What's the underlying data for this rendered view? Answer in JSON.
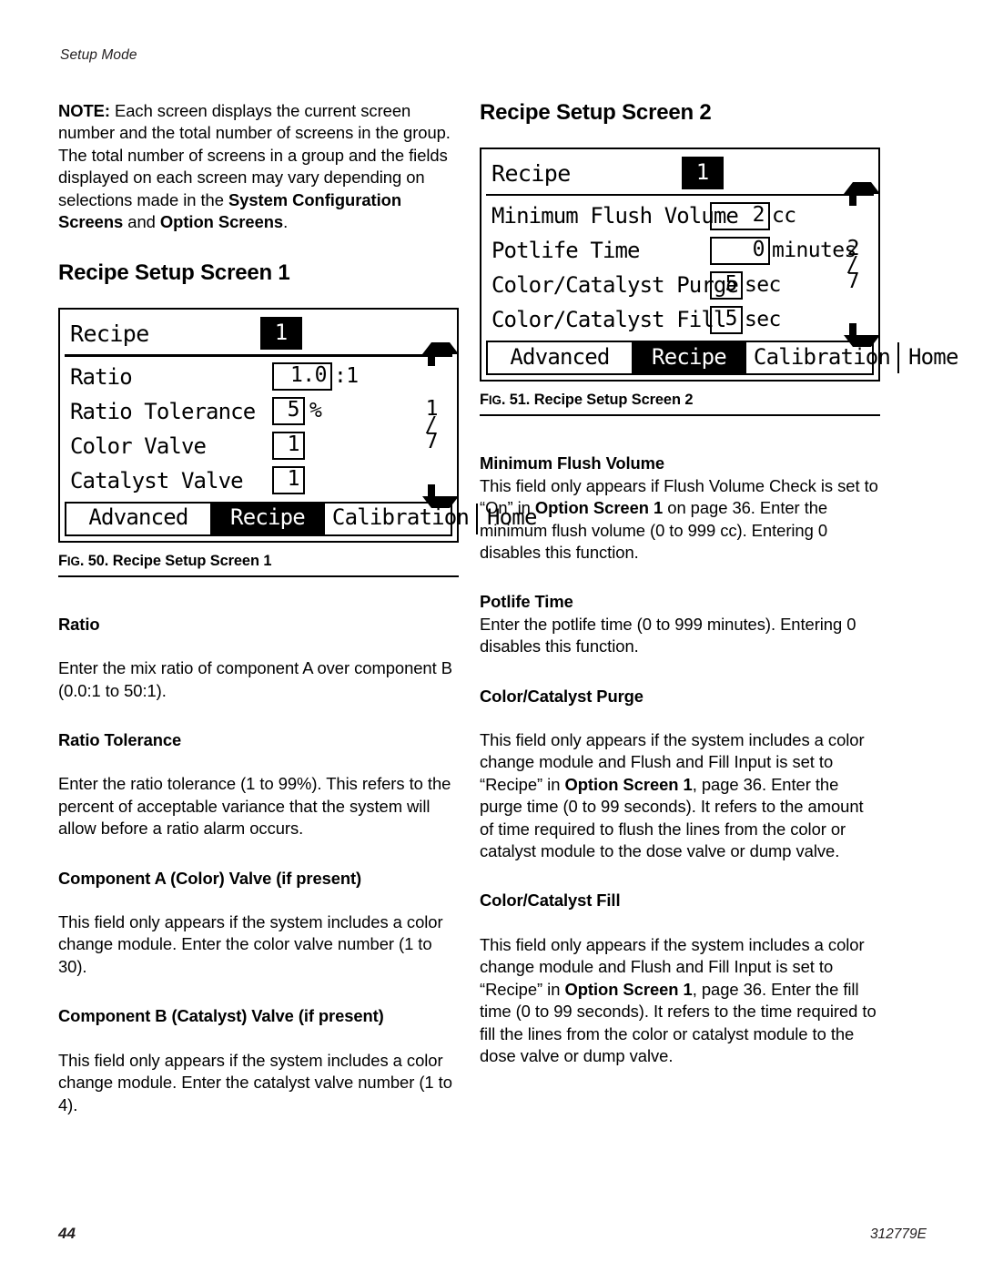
{
  "running_head": "Setup Mode",
  "footer": {
    "page_number": "44",
    "doc_number": "312779E"
  },
  "left_column": {
    "note": {
      "lead": "NOTE:",
      "text_1": " Each screen displays the current screen number and the total number of screens in the group. The total number of screens in a group and the fields displayed on each screen may vary depending on selections made in the ",
      "bold_1": "System Configuration Screens",
      "text_2": " and ",
      "bold_2": "Option Screens",
      "text_3": "."
    },
    "section_title": "Recipe Setup Screen 1",
    "figure_caption": {
      "prefix": "F",
      "small": "IG",
      "rest": ". 50. Recipe Setup Screen 1"
    },
    "sections": [
      {
        "heading": "Ratio",
        "body": "Enter the mix ratio of component A over component B (0.0:1 to 50:1)."
      },
      {
        "heading": "Ratio Tolerance",
        "body": "Enter the ratio tolerance (1 to 99%). This refers to the percent of acceptable variance that the system will allow before a ratio alarm occurs."
      },
      {
        "heading": "Component A (Color) Valve (if present)",
        "body": "This field only appears if the system includes a color change module. Enter the color valve number (1 to 30)."
      },
      {
        "heading": "Component B (Catalyst) Valve (if present)",
        "body": "This field only appears if the system includes a color change module. Enter the catalyst valve number (1 to 4)."
      }
    ]
  },
  "right_column": {
    "section_title": "Recipe Setup Screen 2",
    "figure_caption": {
      "prefix": "F",
      "small": "IG",
      "rest": ". 51. Recipe Setup Screen 2"
    },
    "sections": [
      {
        "heading": "Minimum Flush Volume",
        "body_1": "This field only appears if Flush Volume Check is set to “On” in ",
        "bold": "Option Screen 1",
        "body_2": " on page 36. Enter the minimum flush volume (0 to 999 cc). Entering 0 disables this function."
      },
      {
        "heading": "Potlife Time",
        "body_1": "Enter the potlife time (0 to 999 minutes). Entering 0 disables this function.",
        "bold": "",
        "body_2": ""
      },
      {
        "heading": "Color/Catalyst Purge",
        "body_1": "This field only appears if the system includes a color change module and Flush and Fill Input is set to “Recipe” in ",
        "bold": "Option Screen 1",
        "body_2": ", page 36. Enter the purge time (0 to 99 seconds). It refers to the amount of time required to flush the lines from the color or catalyst module to the dose valve or dump valve."
      },
      {
        "heading": "Color/Catalyst Fill",
        "body_1": "This field only appears if the system includes a color change module and Flush and Fill Input is set to “Recipe” in ",
        "bold": "Option Screen 1",
        "body_2": ", page 36. Enter the fill time (0 to 99 seconds). It refers to the time required to fill the lines from the color or catalyst module to the dose valve or dump valve."
      }
    ]
  },
  "lcd_screen_1": {
    "title_label": "Recipe",
    "title_value": "1",
    "rows": [
      {
        "label": "Ratio",
        "value": "1.0",
        "unit": ":1",
        "box": "w3"
      },
      {
        "label": "Ratio Tolerance",
        "value": "5",
        "unit": "%",
        "box": "w1"
      },
      {
        "label": "Color Valve",
        "value": "1",
        "unit": "",
        "box": "w1"
      },
      {
        "label": "Catalyst Valve",
        "value": "1",
        "unit": "",
        "box": "w1"
      }
    ],
    "scroll": {
      "up_icon": "arrow-up-icon",
      "down_icon": "arrow-down-icon",
      "page": "1",
      "divider": "/",
      "total": "7"
    },
    "tabs": [
      {
        "label": "Advanced",
        "active": false
      },
      {
        "label": "Recipe",
        "active": true
      },
      {
        "label": "Calibration",
        "active": false
      },
      {
        "label": "Home",
        "active": false
      }
    ]
  },
  "lcd_screen_2": {
    "title_label": "Recipe",
    "title_value": "1",
    "rows": [
      {
        "label": "Minimum Flush Volume",
        "value": "2",
        "unit": "cc",
        "box": "w3"
      },
      {
        "label": "Potlife Time",
        "value": "0",
        "unit": "minutes",
        "box": "w3"
      },
      {
        "label": "Color/Catalyst Purge",
        "value": "5",
        "unit": "sec",
        "box": "w1"
      },
      {
        "label": "Color/Catalyst Fill",
        "value": "5",
        "unit": "sec",
        "box": "w1"
      }
    ],
    "scroll": {
      "up_icon": "arrow-up-icon",
      "down_icon": "arrow-down-icon",
      "page": "2",
      "divider": "/",
      "total": "7"
    },
    "tabs": [
      {
        "label": "Advanced",
        "active": false
      },
      {
        "label": "Recipe",
        "active": true
      },
      {
        "label": "Calibration",
        "active": false
      },
      {
        "label": "Home",
        "active": false
      }
    ]
  }
}
